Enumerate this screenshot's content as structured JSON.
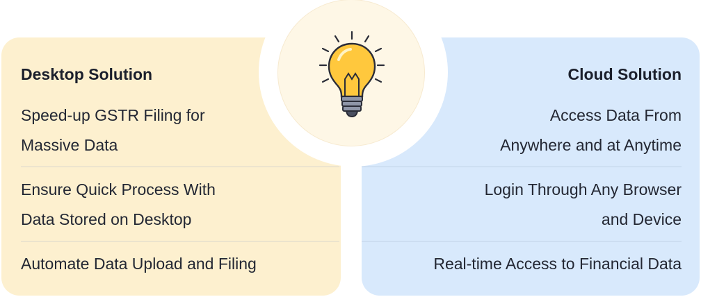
{
  "desktop": {
    "title": "Desktop Solution",
    "features": [
      {
        "line1": "Speed-up GSTR Filing for",
        "line2": "Massive Data"
      },
      {
        "line1": "Ensure Quick Process With",
        "line2": "Data Stored on Desktop"
      },
      {
        "line1": "Automate Data Upload and Filing",
        "line2": ""
      }
    ]
  },
  "cloud": {
    "title": "Cloud Solution",
    "features": [
      {
        "line1": "Access Data From",
        "line2": "Anywhere and at Anytime"
      },
      {
        "line1": "Login Through Any Browser",
        "line2": "and Device"
      },
      {
        "line1": "Real-time Access to Financial Data",
        "line2": ""
      }
    ]
  },
  "icon": {
    "name": "lightbulb-icon"
  },
  "colors": {
    "desktop_panel": "#fdf0cf",
    "cloud_panel": "#d8e9fc",
    "bulb_fill": "#ffc83d",
    "bulb_outline": "#2b2d38"
  }
}
